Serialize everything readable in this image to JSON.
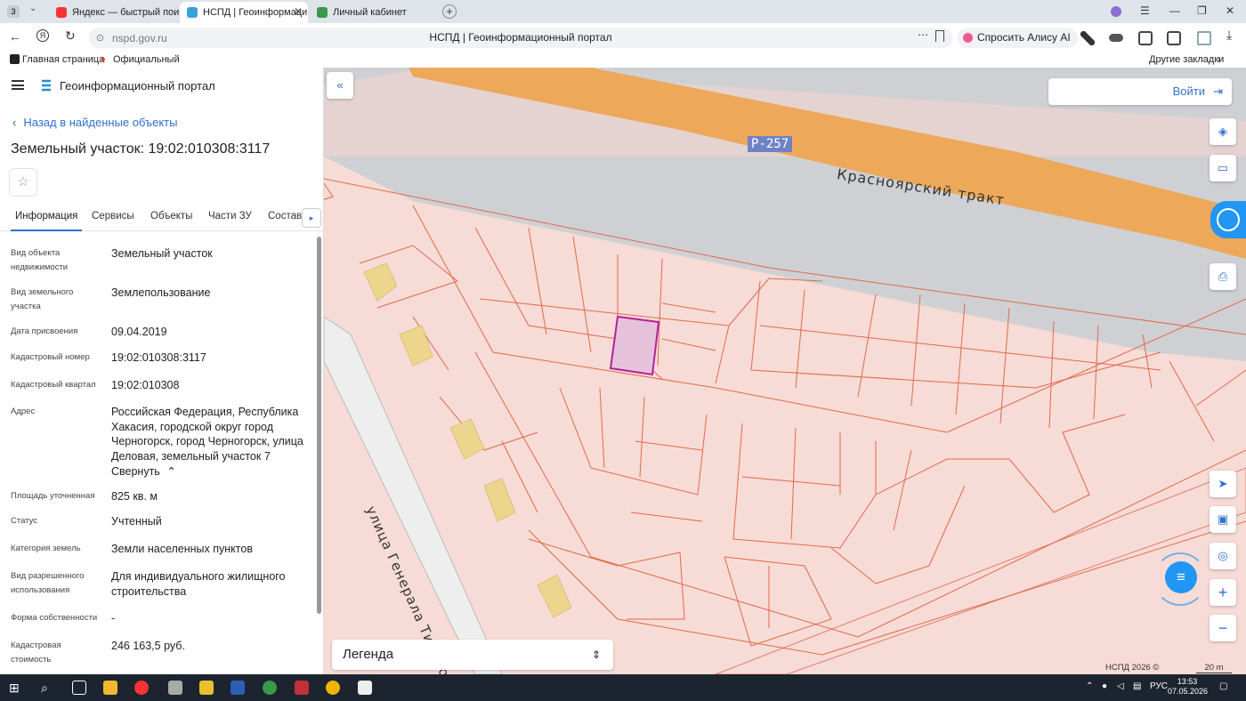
{
  "browser": {
    "tab_count": "3",
    "tabs": [
      {
        "title": "Яндекс — быстрый поиск"
      },
      {
        "title": "НСПД | Геоинформаци"
      },
      {
        "title": "Личный кабинет"
      }
    ],
    "url": "nspd.gov.ru",
    "page_title": "НСПД | Геоинформационный портал",
    "alice_label": "Спросить Алису AI",
    "bookmarks": [
      "Главная страница",
      "Официальный са"
    ],
    "other_bookmarks": "Другие закладки"
  },
  "sidebar": {
    "portal_name": "Геоинформационный портал",
    "back_link": "Назад в найденные объекты",
    "object_title": "Земельный участок: 19:02:010308:3117",
    "tabs": [
      "Информация",
      "Сервисы",
      "Объекты",
      "Части ЗУ",
      "Состав"
    ],
    "fields": [
      {
        "label": "Вид объекта недвижимости",
        "value": "Земельный участок"
      },
      {
        "label": "Вид земельного участка",
        "value": "Землепользование"
      },
      {
        "label": "Дата присвоения",
        "value": "09.04.2019"
      },
      {
        "label": "Кадастровый номер",
        "value": "19:02:010308:3117"
      },
      {
        "label": "Кадастровый квартал",
        "value": "19:02:010308"
      },
      {
        "label": "Адрес",
        "value": "Российская Федерация, Республика Хакасия, городской округ город Черногорск, город Черногорск, улица Деловая, земельный участок 7"
      },
      {
        "label": "Площадь уточненная",
        "value": "825 кв. м"
      },
      {
        "label": "Статус",
        "value": "Учтенный"
      },
      {
        "label": "Категория земель",
        "value": "Земли населенных пунктов"
      },
      {
        "label": "Вид разрешенного использования",
        "value": "Для индивидуального жилищного строительства"
      },
      {
        "label": "Форма собственности",
        "value": "-"
      },
      {
        "label": "Кадастровая стоимость",
        "value": "246 163,5 руб."
      }
    ],
    "collapse_label": "Свернуть"
  },
  "map": {
    "login_label": "Войти",
    "road_badge": "Р-257",
    "road_name": "Красноярский тракт",
    "street_name": "улица Генерала Тихонова",
    "legend_label": "Легенда",
    "copyright": "НСПД 2026 ©",
    "scale_label": "20 m",
    "colors": {
      "parcel_fill": "#f6dbd6",
      "parcel_line": "#e06a4a",
      "selected_fill": "#e6c2da",
      "selected_line": "#b0239c",
      "road": "#eda85a",
      "building": "#ecd68e",
      "accent": "#2f6fd0"
    }
  },
  "taskbar": {
    "lang": "РУС",
    "time": "13:53",
    "date": "07.05.2026"
  }
}
